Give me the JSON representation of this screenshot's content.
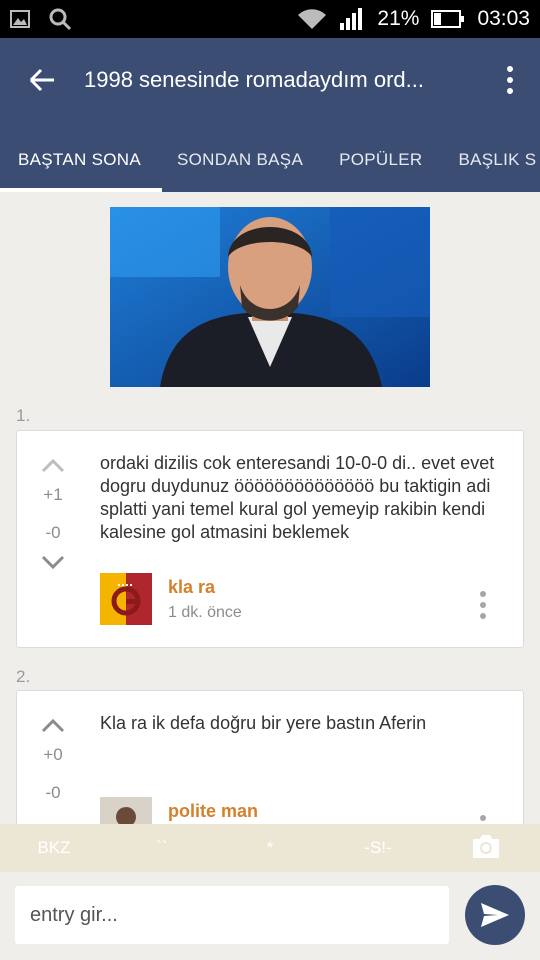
{
  "status": {
    "battery": "21%",
    "time": "03:03"
  },
  "header": {
    "title": "1998 senesinde romadaydım ord..."
  },
  "tabs": [
    {
      "label": "BAŞTAN SONA"
    },
    {
      "label": "SONDAN BAŞA"
    },
    {
      "label": "POPÜLER"
    },
    {
      "label": "BAŞLIK S"
    }
  ],
  "entries": [
    {
      "number": "1.",
      "up": "+1",
      "down": "-0",
      "text": "ordaki dizilis cok enteresandi 10-0-0 di.. evet evet dogru duydunuz öööööööööööööö bu taktigin adi splatti yani temel kural gol yemeyip rakibin kendi kalesine gol atmasini beklemek",
      "author": "kla ra",
      "time": "1 dk. önce"
    },
    {
      "number": "2.",
      "up": "+0",
      "down": "-0",
      "text": "Kla ra ik defa doğru bir yere bastın Aferin",
      "author": "polite man",
      "time": ""
    }
  ],
  "toolbar": {
    "bkz": "BKZ",
    "backtick": "``",
    "star": "*",
    "spoiler": "-S!-"
  },
  "compose": {
    "placeholder": "entry gir..."
  },
  "colors": {
    "primary": "#3c4d73",
    "author": "#d4812e"
  }
}
